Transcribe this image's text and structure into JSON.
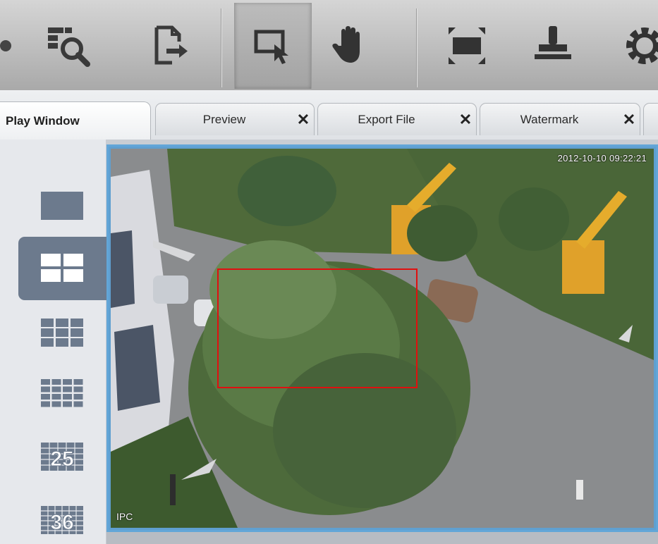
{
  "toolbar": {
    "buttons": [
      {
        "name": "partial-left-icon"
      },
      {
        "name": "search-record-icon"
      },
      {
        "name": "export-file-icon"
      },
      {
        "name": "select-area-icon",
        "active": true
      },
      {
        "name": "hand-pan-icon"
      },
      {
        "name": "fullscreen-icon"
      },
      {
        "name": "watermark-stamp-icon"
      },
      {
        "name": "settings-gear-icon"
      }
    ]
  },
  "tabs": [
    {
      "label": "Play Window",
      "active": true,
      "closable": false
    },
    {
      "label": "Preview",
      "closable": true,
      "close": "✕"
    },
    {
      "label": "Export File",
      "closable": true,
      "close": "✕"
    },
    {
      "label": "Watermark",
      "closable": true,
      "close": "✕"
    }
  ],
  "layout_panel": {
    "items": [
      {
        "name": "layout-1-icon"
      },
      {
        "name": "layout-4-icon",
        "active": true
      },
      {
        "name": "layout-9-icon"
      },
      {
        "name": "layout-16-icon"
      },
      {
        "name": "layout-25-icon",
        "label": "25"
      },
      {
        "name": "layout-36-icon",
        "label": "36"
      }
    ]
  },
  "video": {
    "timestamp": "2012-10-10 09:22:21",
    "channel_label": "IPC"
  },
  "colors": {
    "accent_blue": "#62a6d8",
    "selection_red": "#e01010",
    "active_layout_bg": "#6c7a8d"
  }
}
